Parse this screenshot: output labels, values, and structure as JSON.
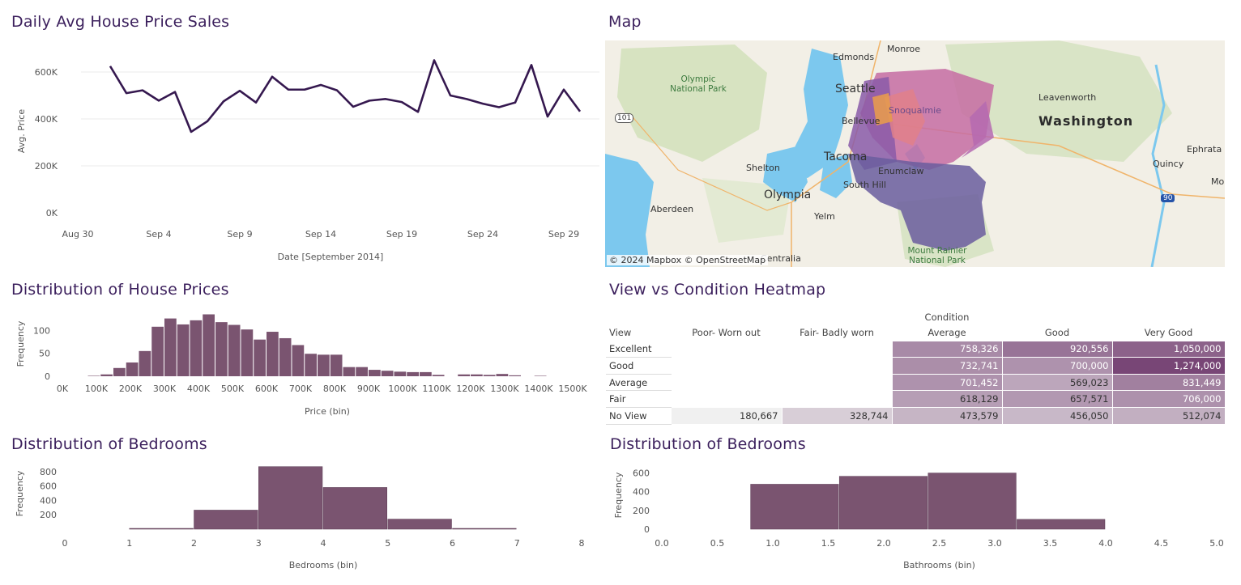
{
  "titles": {
    "line": "Daily Avg House Price Sales",
    "map": "Map",
    "hist_price": "Distribution of House Prices",
    "heatmap": "View vs Condition Heatmap",
    "hist_bedrooms": "Distribution of Bedrooms",
    "hist_bathrooms": "Distribution of Bedrooms"
  },
  "map": {
    "attribution": "© 2024 Mapbox  © OpenStreetMap",
    "labels": {
      "edmonds": "Edmonds",
      "monroe": "Monroe",
      "olympic": "Olympic National Park",
      "seattle": "Seattle",
      "snoqualmie": "Snoqualmie",
      "bellevue": "Bellevue",
      "tacoma": "Tacoma",
      "enumclaw": "Enumclaw",
      "southhill": "South Hill",
      "shelton": "Shelton",
      "olympia": "Olympia",
      "aberdeen": "Aberdeen",
      "yelm": "Yelm",
      "rainier": "Mount Rainier National Park",
      "centralia": "Centralia",
      "leavenworth": "Leavenworth",
      "washington": "Washington",
      "quincy": "Quincy",
      "ephrata": "Ephrata",
      "mo": "Mo",
      "hw101": "101",
      "hw90": "90"
    },
    "colors": {
      "water": "#7cc8ee",
      "land": "#f2efe6",
      "forest": "#c9dcb1",
      "region_purple": "#6a5d9e",
      "region_pink": "#d27c9f",
      "region_orange": "#e59a4f"
    }
  },
  "heatmap": {
    "col_title": "Condition",
    "row_header": "View",
    "columns": [
      "Poor- Worn out",
      "Fair- Badly worn",
      "Average",
      "Good",
      "Very Good"
    ],
    "rows": [
      {
        "label": "Excellent",
        "values": [
          "",
          "",
          "758,326",
          "920,556",
          "1,050,000"
        ]
      },
      {
        "label": "Good",
        "values": [
          "",
          "",
          "732,741",
          "700,000",
          "1,274,000"
        ]
      },
      {
        "label": "Average",
        "values": [
          "",
          "",
          "701,452",
          "569,023",
          "831,449"
        ]
      },
      {
        "label": "Fair",
        "values": [
          "",
          "",
          "618,129",
          "657,571",
          "706,000"
        ]
      },
      {
        "label": "No View",
        "values": [
          "180,667",
          "328,744",
          "473,579",
          "456,050",
          "512,074"
        ]
      }
    ]
  },
  "chart_data": [
    {
      "type": "line",
      "title": "Daily Avg House Price Sales",
      "xlabel": "Date [September 2014]",
      "ylabel": "Avg. Price",
      "x_tick_labels": [
        "Aug 30",
        "Sep 4",
        "Sep 9",
        "Sep 14",
        "Sep 19",
        "Sep 24",
        "Sep 29"
      ],
      "y_tick_labels": [
        "0K",
        "200K",
        "400K",
        "600K"
      ],
      "ylim": [
        0,
        700000
      ],
      "x": [
        "2014-09-01",
        "2014-09-02",
        "2014-09-03",
        "2014-09-04",
        "2014-09-05",
        "2014-09-06",
        "2014-09-07",
        "2014-09-08",
        "2014-09-09",
        "2014-09-10",
        "2014-09-11",
        "2014-09-12",
        "2014-09-13",
        "2014-09-14",
        "2014-09-15",
        "2014-09-16",
        "2014-09-17",
        "2014-09-18",
        "2014-09-19",
        "2014-09-20",
        "2014-09-21",
        "2014-09-22",
        "2014-09-23",
        "2014-09-24",
        "2014-09-25",
        "2014-09-26",
        "2014-09-27",
        "2014-09-28",
        "2014-09-29",
        "2014-09-30"
      ],
      "values": [
        625000,
        510000,
        522000,
        478000,
        515000,
        345000,
        390000,
        475000,
        520000,
        470000,
        580000,
        525000,
        525000,
        545000,
        522000,
        452000,
        478000,
        485000,
        472000,
        430000,
        650000,
        500000,
        485000,
        465000,
        450000,
        470000,
        630000,
        410000,
        525000,
        432000
      ],
      "color": "#35184f",
      "grid": true
    },
    {
      "type": "bar",
      "title": "Distribution of House Prices",
      "xlabel": "Price (bin)",
      "ylabel": "Frequency",
      "x_tick_labels": [
        "0K",
        "100K",
        "200K",
        "300K",
        "400K",
        "500K",
        "600K",
        "700K",
        "800K",
        "900K",
        "1000K",
        "1100K",
        "1200K",
        "1300K",
        "1400K",
        "1500K"
      ],
      "y_tick_labels": [
        "0",
        "50",
        "100"
      ],
      "ylim": [
        0,
        150
      ],
      "bin_width": 37500,
      "bin_start": 75000,
      "values": [
        1,
        4,
        18,
        30,
        55,
        108,
        126,
        113,
        122,
        135,
        118,
        112,
        102,
        80,
        97,
        83,
        68,
        49,
        47,
        47,
        20,
        20,
        14,
        12,
        10,
        9,
        9,
        3,
        0,
        4,
        4,
        3,
        5,
        2,
        0,
        1
      ],
      "color": "#7a5470"
    },
    {
      "type": "bar",
      "title": "Distribution of Bedrooms",
      "xlabel": "Bedrooms (bin)",
      "ylabel": "Frequency",
      "x_tick_labels": [
        "0",
        "1",
        "2",
        "3",
        "4",
        "5",
        "6",
        "7",
        "8"
      ],
      "y_tick_labels": [
        "200",
        "400",
        "600",
        "800"
      ],
      "xlim": [
        0,
        8
      ],
      "ylim": [
        0,
        900
      ],
      "bins": [
        [
          1,
          2
        ],
        [
          2,
          3
        ],
        [
          3,
          4
        ],
        [
          4,
          5
        ],
        [
          5,
          6
        ],
        [
          6,
          7
        ]
      ],
      "values": [
        10,
        265,
        870,
        580,
        140,
        10
      ],
      "color": "#7a5470"
    },
    {
      "type": "bar",
      "title": "Distribution of Bedrooms",
      "xlabel": "Bathrooms (bin)",
      "ylabel": "Frequency",
      "x_tick_labels": [
        "0.0",
        "0.5",
        "1.0",
        "1.5",
        "2.0",
        "2.5",
        "3.0",
        "3.5",
        "4.0",
        "4.5",
        "5.0"
      ],
      "y_tick_labels": [
        "0",
        "200",
        "400",
        "600"
      ],
      "xlim": [
        0,
        5
      ],
      "ylim": [
        0,
        700
      ],
      "bins": [
        [
          0.8,
          1.6
        ],
        [
          1.6,
          2.4
        ],
        [
          2.4,
          3.2
        ],
        [
          3.2,
          4.0
        ]
      ],
      "values": [
        480,
        565,
        600,
        105
      ],
      "color": "#7a5470"
    }
  ]
}
